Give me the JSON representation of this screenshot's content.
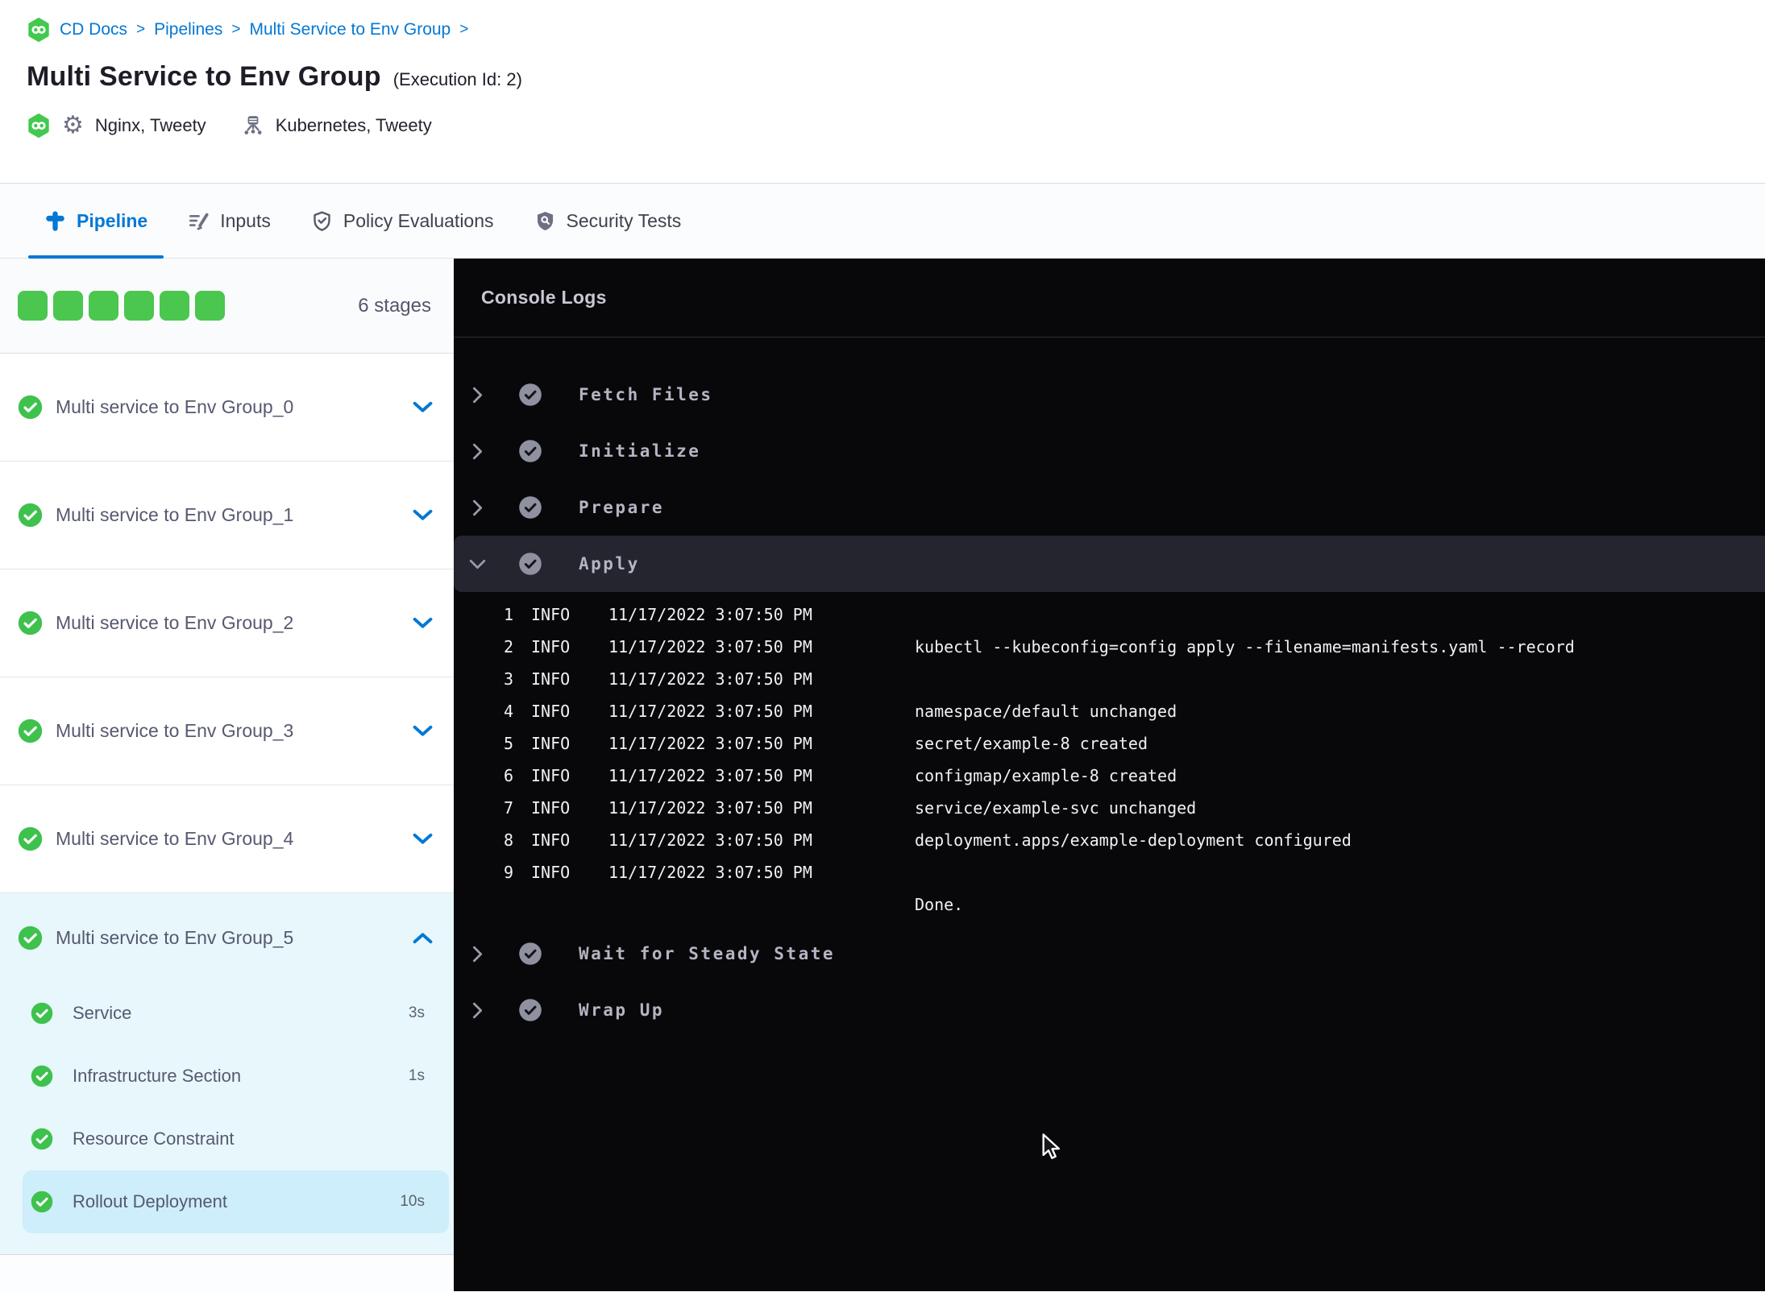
{
  "breadcrumb": {
    "items": [
      "CD Docs",
      "Pipelines",
      "Multi Service to Env Group"
    ],
    "separator": ">"
  },
  "header": {
    "title": "Multi Service to Env Group",
    "execution_id_label": "(Execution Id: 2)",
    "services_label": "Nginx, Tweety",
    "environments_label": "Kubernetes, Tweety"
  },
  "tabs": [
    {
      "label": "Pipeline",
      "icon": "pipeline-icon",
      "active": true
    },
    {
      "label": "Inputs",
      "icon": "inputs-icon",
      "active": false
    },
    {
      "label": "Policy Evaluations",
      "icon": "policy-shield-icon",
      "active": false
    },
    {
      "label": "Security Tests",
      "icon": "security-shield-icon",
      "active": false
    }
  ],
  "sidebar": {
    "stage_count_label": "6 stages",
    "stage_squares": 6,
    "stages": [
      {
        "label": "Multi service to Env Group_0",
        "status": "success",
        "expanded": false
      },
      {
        "label": "Multi service to Env Group_1",
        "status": "success",
        "expanded": false
      },
      {
        "label": "Multi service to Env Group_2",
        "status": "success",
        "expanded": false
      },
      {
        "label": "Multi service to Env Group_3",
        "status": "success",
        "expanded": false
      },
      {
        "label": "Multi service to Env Group_4",
        "status": "success",
        "expanded": false
      },
      {
        "label": "Multi service to Env Group_5",
        "status": "success",
        "expanded": true,
        "steps": [
          {
            "label": "Service",
            "duration": "3s",
            "status": "success",
            "selected": false
          },
          {
            "label": "Infrastructure Section",
            "duration": "1s",
            "status": "success",
            "selected": false
          },
          {
            "label": "Resource Constraint",
            "duration": "",
            "status": "success",
            "selected": false
          },
          {
            "label": "Rollout Deployment",
            "duration": "10s",
            "status": "success",
            "selected": true
          }
        ]
      }
    ]
  },
  "console": {
    "title": "Console Logs",
    "steps": [
      {
        "label": "Fetch Files",
        "status": "success",
        "expanded": false
      },
      {
        "label": "Initialize",
        "status": "success",
        "expanded": false
      },
      {
        "label": "Prepare",
        "status": "success",
        "expanded": false
      },
      {
        "label": "Apply",
        "status": "success",
        "expanded": true,
        "logs": [
          {
            "num": "1",
            "level": "INFO",
            "timestamp": "11/17/2022 3:07:50 PM",
            "message": ""
          },
          {
            "num": "2",
            "level": "INFO",
            "timestamp": "11/17/2022 3:07:50 PM",
            "message": "kubectl --kubeconfig=config apply --filename=manifests.yaml --record"
          },
          {
            "num": "3",
            "level": "INFO",
            "timestamp": "11/17/2022 3:07:50 PM",
            "message": ""
          },
          {
            "num": "4",
            "level": "INFO",
            "timestamp": "11/17/2022 3:07:50 PM",
            "message": "namespace/default unchanged"
          },
          {
            "num": "5",
            "level": "INFO",
            "timestamp": "11/17/2022 3:07:50 PM",
            "message": "secret/example-8 created"
          },
          {
            "num": "6",
            "level": "INFO",
            "timestamp": "11/17/2022 3:07:50 PM",
            "message": "configmap/example-8 created"
          },
          {
            "num": "7",
            "level": "INFO",
            "timestamp": "11/17/2022 3:07:50 PM",
            "message": "service/example-svc unchanged"
          },
          {
            "num": "8",
            "level": "INFO",
            "timestamp": "11/17/2022 3:07:50 PM",
            "message": "deployment.apps/example-deployment configured"
          },
          {
            "num": "9",
            "level": "INFO",
            "timestamp": "11/17/2022 3:07:50 PM",
            "message": ""
          },
          {
            "num": "",
            "level": "",
            "timestamp": "",
            "message": "Done."
          }
        ]
      },
      {
        "label": "Wait for Steady State",
        "status": "success",
        "expanded": false
      },
      {
        "label": "Wrap Up",
        "status": "success",
        "expanded": false
      }
    ]
  },
  "colors": {
    "accent_blue": "#0278d5",
    "success_green": "#3fc14d",
    "stage_square_green": "#4bc64f",
    "expanded_stage_bg": "#e7f7fc",
    "selected_step_bg": "#cdeefa",
    "console_bg": "#08080b",
    "console_step_highlight": "#24252e",
    "console_text": "#f0f1f5"
  }
}
